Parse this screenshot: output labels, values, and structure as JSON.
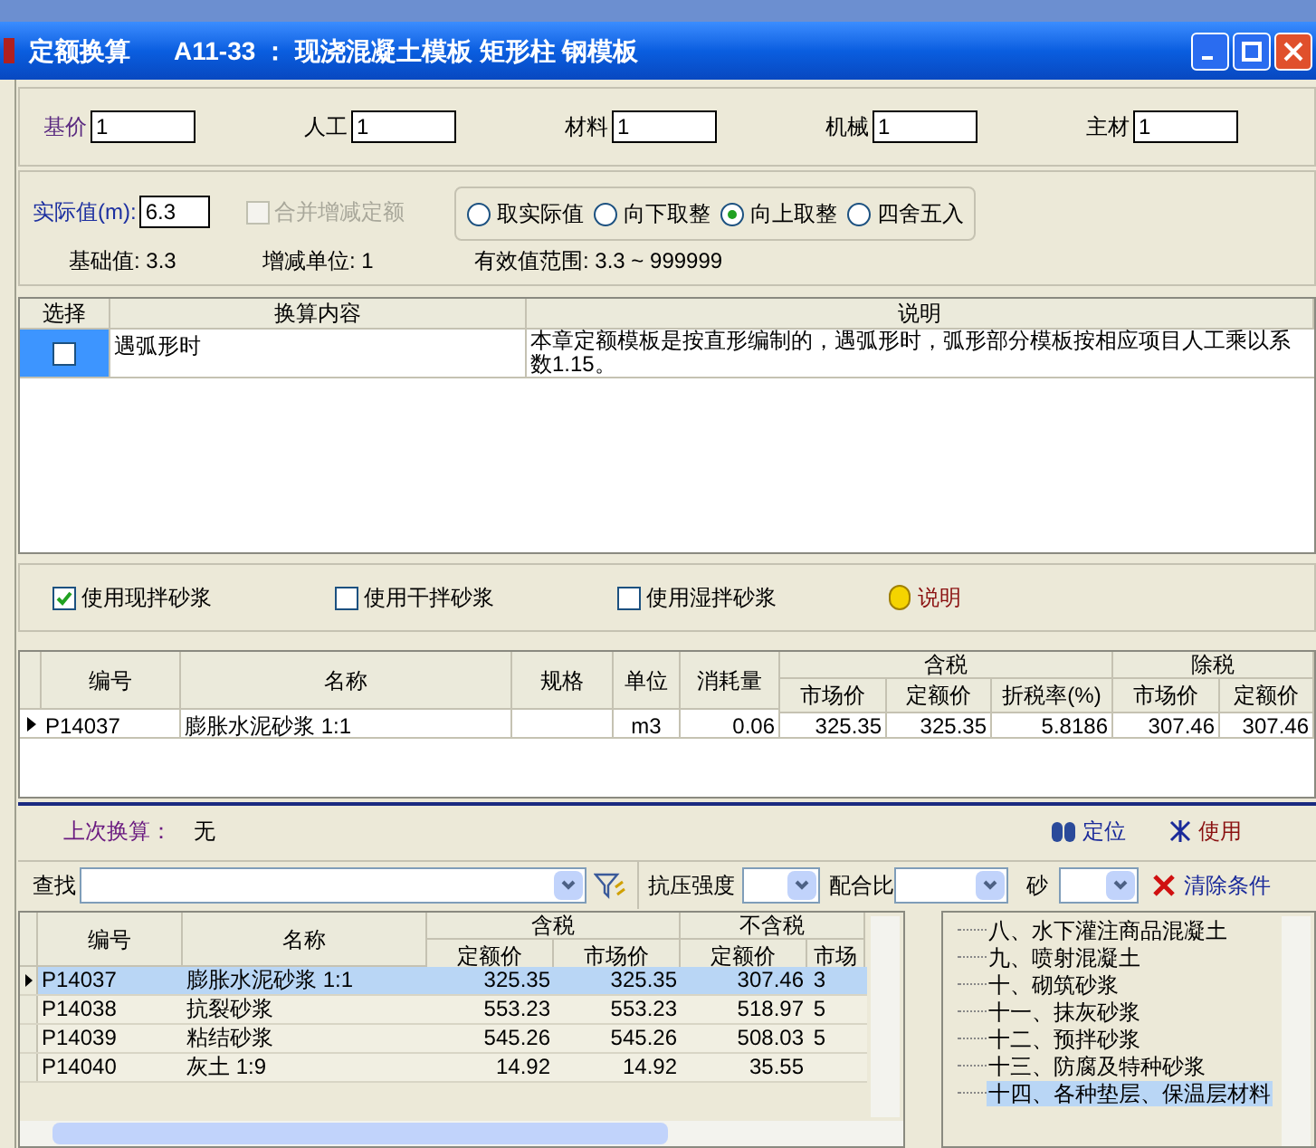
{
  "window": {
    "title": "定额换算",
    "subtitle": "A11-33 ： 现浇混凝土模板 矩形柱 钢模板"
  },
  "coefficients": [
    {
      "label": "基价",
      "value": "1"
    },
    {
      "label": "人工",
      "value": "1"
    },
    {
      "label": "材料",
      "value": "1"
    },
    {
      "label": "机械",
      "value": "1"
    },
    {
      "label": "主材",
      "value": "1"
    }
  ],
  "actual": {
    "label": "实际值(m):",
    "value": "6.3",
    "merge": {
      "label": "合并增减定额",
      "checked": false,
      "disabled": true
    },
    "rounding": [
      {
        "label": "取实际值",
        "selected": false
      },
      {
        "label": "向下取整",
        "selected": false
      },
      {
        "label": "向上取整",
        "selected": true
      },
      {
        "label": "四舍五入",
        "selected": false
      }
    ],
    "info": [
      "基础值: 3.3",
      "增减单位: 1",
      "有效值范围: 3.3 ~ 999999"
    ]
  },
  "conversions": {
    "columns": [
      "选择",
      "换算内容",
      "说明"
    ],
    "rows": [
      {
        "checked": false,
        "selected": true,
        "content": "遇弧形时",
        "note": "本章定额模板是按直形编制的，遇弧形时，弧形部分模板按相应项目人工乘以系数1.15。"
      }
    ]
  },
  "mortar": {
    "options": [
      {
        "label": "使用现拌砂浆",
        "checked": true
      },
      {
        "label": "使用干拌砂浆",
        "checked": false
      },
      {
        "label": "使用湿拌砂浆",
        "checked": false
      }
    ],
    "help": "说明"
  },
  "materials": {
    "columns": [
      "编号",
      "名称",
      "规格",
      "单位",
      "消耗量"
    ],
    "group_taxed": "含税",
    "taxed_columns": [
      "市场价",
      "定额价",
      "折税率(%)"
    ],
    "group_untaxed": "除税",
    "untaxed_columns": [
      "市场价",
      "定额价"
    ],
    "rows": [
      {
        "cells": [
          "P14037",
          "膨胀水泥砂浆 1:1",
          "",
          "m3",
          "0.06",
          "325.35",
          "325.35",
          "5.8186",
          "307.46",
          "307.46"
        ]
      }
    ]
  },
  "last": {
    "label": "上次换算：",
    "value": "无",
    "locate": "定位",
    "use": "使用"
  },
  "filter": {
    "search_label": "查找",
    "strength_label": "抗压强度",
    "ratio_label": "配合比",
    "sand_label": "砂",
    "clear": "清除条件"
  },
  "catalog": {
    "columns": [
      "编号",
      "名称"
    ],
    "group_taxed": "含税",
    "taxed_columns": [
      "定额价",
      "市场价"
    ],
    "group_untaxed": "不含税",
    "untaxed_columns": [
      "定额价",
      "市场"
    ],
    "rows": [
      {
        "selected": true,
        "cells": [
          "P14037",
          "膨胀水泥砂浆 1:1",
          "325.35",
          "325.35",
          "307.46",
          "3"
        ]
      },
      {
        "selected": false,
        "cells": [
          "P14038",
          "抗裂砂浆",
          "553.23",
          "553.23",
          "518.97",
          "5"
        ]
      },
      {
        "selected": false,
        "cells": [
          "P14039",
          "粘结砂浆",
          "545.26",
          "545.26",
          "508.03",
          "5"
        ]
      },
      {
        "selected": false,
        "cells": [
          "P14040",
          "灰土 1:9",
          "14.92",
          "14.92",
          "35.55",
          ""
        ]
      }
    ]
  },
  "tree": [
    {
      "label": "八、水下灌注商品混凝土",
      "selected": false
    },
    {
      "label": "九、喷射混凝土",
      "selected": false
    },
    {
      "label": "十、砌筑砂浆",
      "selected": false
    },
    {
      "label": "十一、抹灰砂浆",
      "selected": false
    },
    {
      "label": "十二、预拌砂浆",
      "selected": false
    },
    {
      "label": "十三、防腐及特种砂浆",
      "selected": false
    },
    {
      "label": "十四、各种垫层、保温层材料",
      "selected": true
    }
  ]
}
